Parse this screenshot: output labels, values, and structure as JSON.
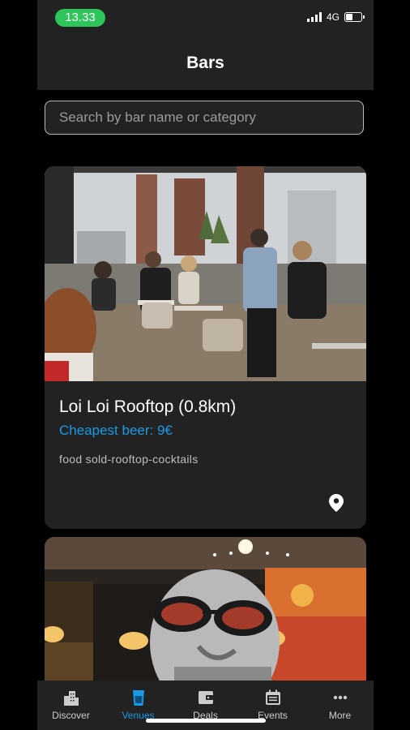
{
  "status": {
    "time": "13.33",
    "network": "4G"
  },
  "header": {
    "title": "Bars"
  },
  "search": {
    "placeholder": "Search by bar name or category"
  },
  "venues": [
    {
      "name": "Loi Loi Rooftop (0.8km)",
      "price_text": "Cheapest beer: 9€",
      "tags": "food sold-rooftop-cocktails",
      "icon": "location-pin-icon"
    }
  ],
  "tabbar": {
    "items": [
      {
        "label": "Discover",
        "icon": "city-icon"
      },
      {
        "label": "Venues",
        "icon": "beer-glass-icon"
      },
      {
        "label": "Deals",
        "icon": "wallet-icon"
      },
      {
        "label": "Events",
        "icon": "calendar-icon"
      },
      {
        "label": "More",
        "icon": "more-dots-icon"
      }
    ],
    "active": "Venues"
  },
  "colors": {
    "accent": "#1a9ae6",
    "status_pill": "#2ec55a",
    "surface": "#222222",
    "background": "#000000"
  }
}
